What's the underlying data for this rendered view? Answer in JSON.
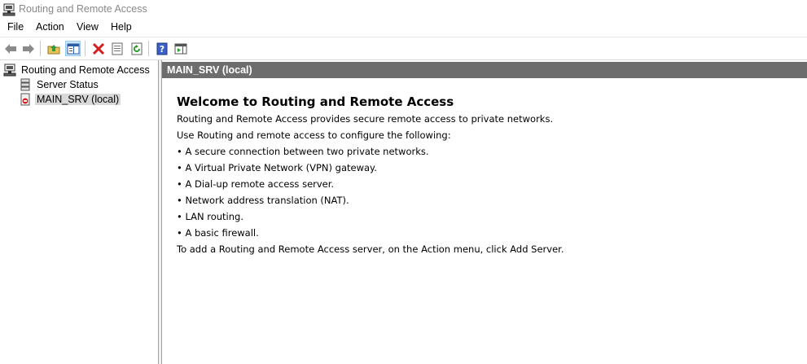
{
  "window": {
    "title": "Routing and Remote Access"
  },
  "menu": {
    "file": "File",
    "action": "Action",
    "view": "View",
    "help": "Help"
  },
  "toolbar": {
    "buttons": [
      "back-icon",
      "forward-icon",
      "up-folder-icon",
      "show-hide-tree-icon",
      "delete-icon",
      "properties-icon",
      "refresh-icon",
      "help-icon",
      "console-tree-icon"
    ]
  },
  "tree": {
    "root": "Routing and Remote Access",
    "server_status": "Server Status",
    "server": "MAIN_SRV (local)"
  },
  "content": {
    "header": "MAIN_SRV (local)",
    "welcome_title": "Welcome to Routing and Remote Access",
    "lines": [
      "Routing and Remote Access provides secure remote access to private networks.",
      "Use Routing and remote access to configure the following:",
      "• A secure connection between two private networks.",
      "• A Virtual Private Network (VPN) gateway.",
      "• A Dial-up remote access server.",
      "• Network address translation (NAT).",
      "• LAN routing.",
      "• A basic firewall.",
      "To add a Routing and Remote Access server, on the Action menu, click Add Server."
    ]
  },
  "colors": {
    "header_bg": "#6d6d6d",
    "selected_bg": "#d9d9d9",
    "pressed_bg": "#cce4f7"
  }
}
